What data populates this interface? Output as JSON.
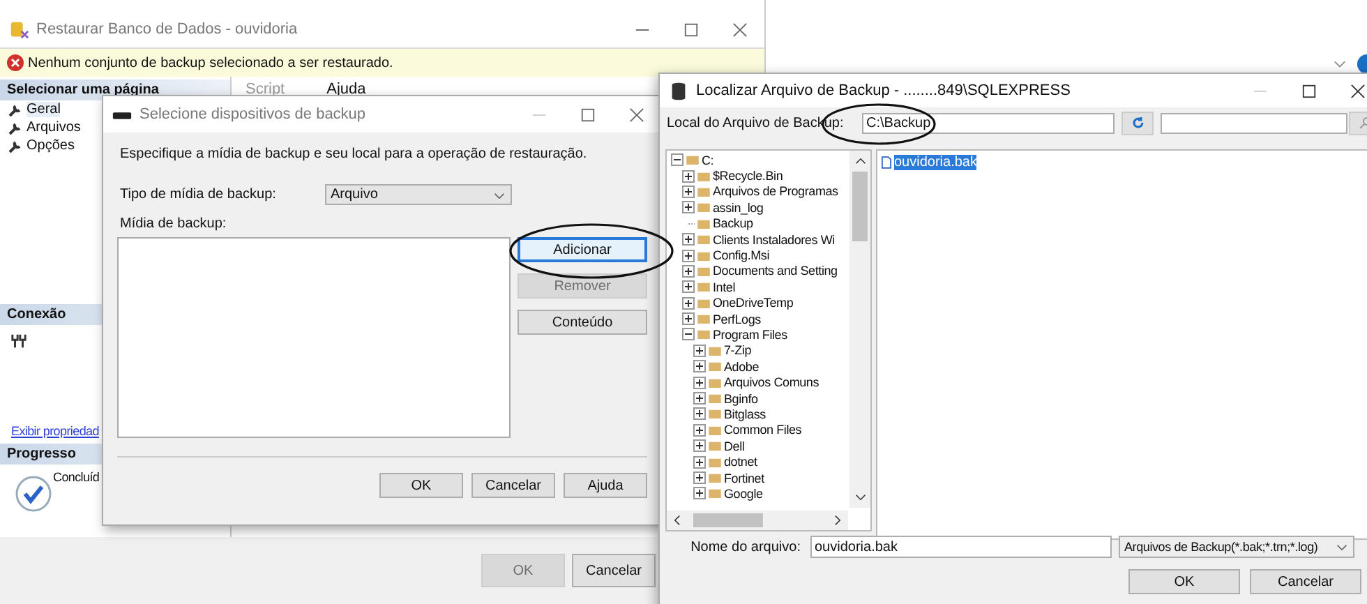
{
  "restore_window": {
    "title": "Restaurar Banco de Dados - ouvidoria",
    "error": "Nenhum conjunto de backup selecionado a ser restaurado.",
    "page_header": "Selecionar uma página",
    "pages": [
      {
        "label": "Geral",
        "selected": true
      },
      {
        "label": "Arquivos",
        "selected": false
      },
      {
        "label": "Opções",
        "selected": false
      }
    ],
    "toolbar": [
      {
        "label": "Script",
        "disabled": true
      },
      {
        "label": "Ajuda",
        "disabled": false
      }
    ],
    "connection_header": "Conexão",
    "view_properties_link": "Exibir propriedad",
    "progress_header": "Progresso",
    "progress_status": "Concluíd",
    "buttons": [
      {
        "label": "OK",
        "disabled": true
      },
      {
        "label": "Cancelar",
        "disabled": false
      }
    ]
  },
  "device_dialog": {
    "title": "Selecione dispositivos de backup",
    "description": "Especifique a mídia de backup e seu local para a operação de restauração.",
    "media_type_label": "Tipo de mídia de backup:",
    "media_type_value": "Arquivo",
    "media_label": "Mídia de backup:",
    "side_buttons": [
      {
        "label": "Adicionar",
        "disabled": false,
        "focused": true
      },
      {
        "label": "Remover",
        "disabled": true,
        "focused": false
      },
      {
        "label": "Conteúdo",
        "disabled": false,
        "focused": false
      }
    ],
    "buttons": [
      "OK",
      "Cancelar",
      "Ajuda"
    ]
  },
  "locate_dialog": {
    "title": "Localizar Arquivo de Backup - ........849\\SQLEXPRESS",
    "path_label": "Local do Arquivo de Backup:",
    "path_value": "C:\\Backup",
    "tree": [
      {
        "label": "C:",
        "expandable": true,
        "expanded": true,
        "children": [
          {
            "label": "$Recycle.Bin",
            "expandable": true,
            "expanded": false
          },
          {
            "label": "Arquivos de Programas",
            "expandable": true,
            "expanded": false
          },
          {
            "label": "assin_log",
            "expandable": true,
            "expanded": false
          },
          {
            "label": "Backup",
            "expandable": false
          },
          {
            "label": "Clients Instaladores Wi",
            "expandable": true,
            "expanded": false
          },
          {
            "label": "Config.Msi",
            "expandable": true,
            "expanded": false
          },
          {
            "label": "Documents and Setting",
            "expandable": true,
            "expanded": false
          },
          {
            "label": "Intel",
            "expandable": true,
            "expanded": false
          },
          {
            "label": "OneDriveTemp",
            "expandable": true,
            "expanded": false
          },
          {
            "label": "PerfLogs",
            "expandable": true,
            "expanded": false
          },
          {
            "label": "Program Files",
            "expandable": true,
            "expanded": true,
            "children": [
              {
                "label": "7-Zip",
                "expandable": true,
                "expanded": false
              },
              {
                "label": "Adobe",
                "expandable": true,
                "expanded": false
              },
              {
                "label": "Arquivos Comuns",
                "expandable": true,
                "expanded": false
              },
              {
                "label": "Bginfo",
                "expandable": true,
                "expanded": false
              },
              {
                "label": "Bitglass",
                "expandable": true,
                "expanded": false
              },
              {
                "label": "Common Files",
                "expandable": true,
                "expanded": false
              },
              {
                "label": "Dell",
                "expandable": true,
                "expanded": false
              },
              {
                "label": "dotnet",
                "expandable": true,
                "expanded": false
              },
              {
                "label": "Fortinet",
                "expandable": true,
                "expanded": false
              },
              {
                "label": "Google",
                "expandable": true,
                "expanded": false
              }
            ]
          }
        ]
      }
    ],
    "files": [
      {
        "name": "ouvidoria.bak",
        "selected": true
      }
    ],
    "file_name_label": "Nome do arquivo:",
    "file_name_value": "ouvidoria.bak",
    "filter": "Arquivos de Backup(*.bak;*.trn;*.log)",
    "buttons": [
      "OK",
      "Cancelar"
    ]
  }
}
